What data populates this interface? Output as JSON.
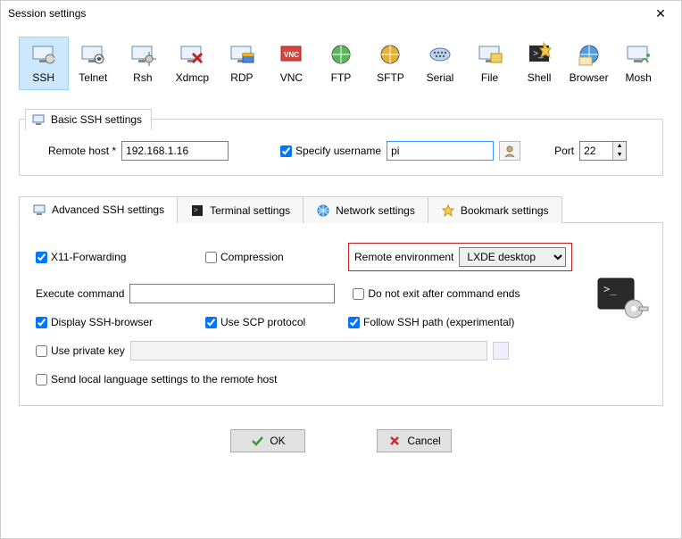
{
  "window": {
    "title": "Session settings"
  },
  "protocols": [
    {
      "id": "ssh",
      "label": "SSH",
      "selected": true
    },
    {
      "id": "telnet",
      "label": "Telnet"
    },
    {
      "id": "rsh",
      "label": "Rsh"
    },
    {
      "id": "xdmcp",
      "label": "Xdmcp"
    },
    {
      "id": "rdp",
      "label": "RDP"
    },
    {
      "id": "vnc",
      "label": "VNC"
    },
    {
      "id": "ftp",
      "label": "FTP"
    },
    {
      "id": "sftp",
      "label": "SFTP"
    },
    {
      "id": "serial",
      "label": "Serial"
    },
    {
      "id": "file",
      "label": "File"
    },
    {
      "id": "shell",
      "label": "Shell"
    },
    {
      "id": "browser",
      "label": "Browser"
    },
    {
      "id": "mosh",
      "label": "Mosh"
    }
  ],
  "basic": {
    "group_title": "Basic SSH settings",
    "remote_host_label": "Remote host *",
    "remote_host_value": "192.168.1.16",
    "specify_username_label": "Specify username",
    "specify_username_checked": true,
    "username_value": "pi",
    "port_label": "Port",
    "port_value": "22"
  },
  "tabs": {
    "advanced": "Advanced SSH settings",
    "terminal": "Terminal settings",
    "network": "Network settings",
    "bookmark": "Bookmark settings"
  },
  "advanced": {
    "x11_label": "X11-Forwarding",
    "x11_checked": true,
    "compression_label": "Compression",
    "compression_checked": false,
    "remote_env_label": "Remote environment",
    "remote_env_value": "LXDE desktop",
    "execute_cmd_label": "Execute command",
    "execute_cmd_value": "",
    "noexit_label": "Do not exit after command ends",
    "noexit_checked": false,
    "ssh_browser_label": "Display SSH-browser",
    "ssh_browser_checked": true,
    "scp_label": "Use SCP protocol",
    "scp_checked": true,
    "follow_label": "Follow SSH path (experimental)",
    "follow_checked": true,
    "private_key_label": "Use private key",
    "private_key_checked": false,
    "private_key_value": "",
    "send_lang_label": "Send local language settings to the remote host",
    "send_lang_checked": false
  },
  "buttons": {
    "ok": "OK",
    "cancel": "Cancel"
  },
  "icons": {
    "monitor": "monitor-icon",
    "terminal": "terminal-icon",
    "globe": "globe-icon",
    "star": "star-icon",
    "user": "user-icon",
    "check": "check-icon",
    "cross": "cross-icon"
  }
}
